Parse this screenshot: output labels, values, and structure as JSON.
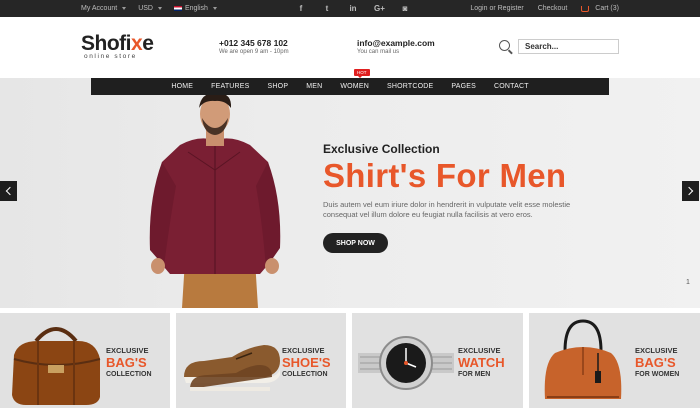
{
  "topbar": {
    "account": "My Account",
    "currency": "USD",
    "language": "English",
    "social": [
      {
        "icon": "facebook-icon",
        "glyph": "f"
      },
      {
        "icon": "twitter-icon",
        "glyph": "t"
      },
      {
        "icon": "linkedin-icon",
        "glyph": "in"
      },
      {
        "icon": "google-plus-icon",
        "glyph": "G+"
      },
      {
        "icon": "instagram-icon",
        "glyph": "◙"
      }
    ],
    "login": "Login or Register",
    "checkout": "Checkout",
    "cart": "Cart (3)"
  },
  "header": {
    "logo_main": "Shofi",
    "logo_accent": "x",
    "logo_end": "e",
    "logo_tagline": "online store",
    "phone": "+012 345 678 102",
    "phone_note": "We are open 9 am - 10pm",
    "email": "info@example.com",
    "email_note": "You can mail us",
    "search_placeholder": "Search..."
  },
  "nav": {
    "items": [
      "HOME",
      "FEATURES",
      "SHOP",
      "MEN",
      "WOMEN",
      "SHORTCODE",
      "PAGES",
      "CONTACT"
    ],
    "hot_badge": "HOT"
  },
  "hero": {
    "eyebrow": "Exclusive Collection",
    "title": "Shirt's For Men",
    "desc_line1": "Duis autem vel eum iriure dolor in hendrerit in vulputate velit esse molestie",
    "desc_line2": "consequat vel illum dolore eu feugiat nulla facilisis at vero eros.",
    "button": "SHOP NOW",
    "slide_number": "1"
  },
  "categories": [
    {
      "line1": "EXCLUSIVE",
      "line2": "BAG'S",
      "line3": "COLLECTION",
      "icon": "leather-bag-icon"
    },
    {
      "line1": "EXCLUSIVE",
      "line2": "SHOE'S",
      "line3": "COLLECTION",
      "icon": "shoe-icon"
    },
    {
      "line1": "EXCLUSIVE",
      "line2": "WATCH",
      "line3": "FOR MEN",
      "icon": "watch-icon"
    },
    {
      "line1": "EXCLUSIVE",
      "line2": "BAG'S",
      "line3": "FOR WOMEN",
      "icon": "handbag-icon"
    }
  ],
  "colors": {
    "accent": "#e8572a",
    "dark": "#262626"
  }
}
